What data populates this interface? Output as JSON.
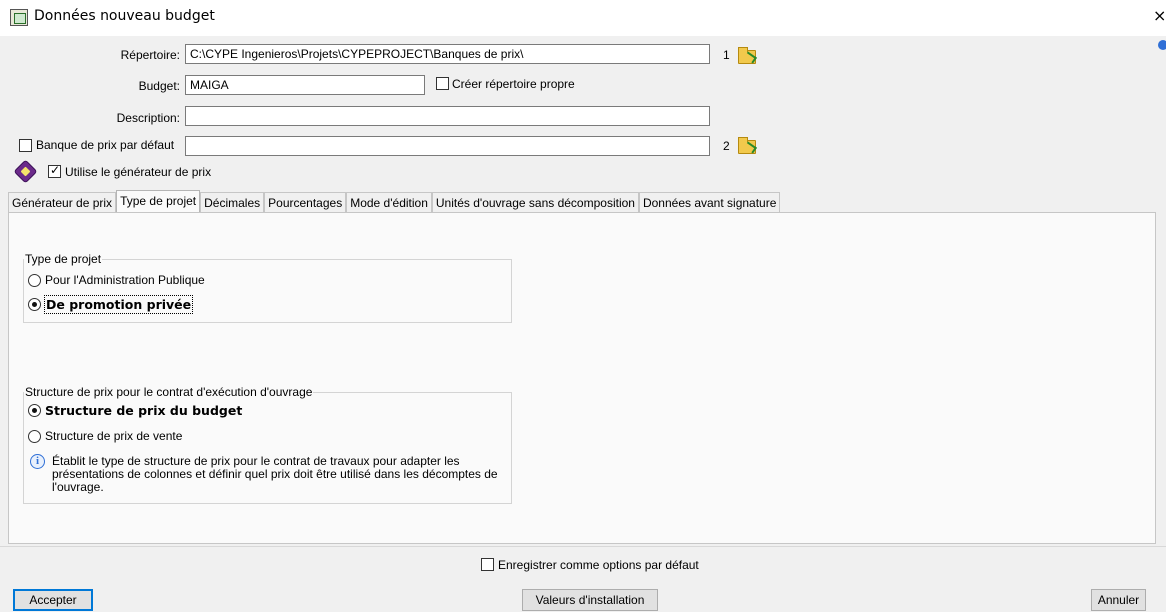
{
  "window": {
    "title": "Données nouveau budget",
    "close_glyph": "×"
  },
  "fields": {
    "repertoire": {
      "label": "Répertoire:",
      "value": "C:\\CYPE Ingenieros\\Projets\\CYPEPROJECT\\Banques de prix\\",
      "index": "1"
    },
    "budget": {
      "label": "Budget:",
      "value": "MAIGA"
    },
    "creer_repertoire": {
      "label": "Créer répertoire propre",
      "checked": false
    },
    "description": {
      "label": "Description:",
      "value": ""
    },
    "banque_defaut": {
      "label": "Banque de prix par défaut",
      "checked": false,
      "value": "",
      "index": "2"
    },
    "utilise_generateur": {
      "label": "Utilise le générateur de prix",
      "checked": true
    }
  },
  "tabs": [
    {
      "label": "Générateur de prix",
      "active": false
    },
    {
      "label": "Type de projet",
      "active": true
    },
    {
      "label": "Décimales",
      "active": false
    },
    {
      "label": "Pourcentages",
      "active": false
    },
    {
      "label": "Mode d'édition",
      "active": false
    },
    {
      "label": "Unités d'ouvrage sans décomposition",
      "active": false
    },
    {
      "label": "Données avant signature",
      "active": false
    }
  ],
  "type_projet": {
    "title": "Type de projet",
    "options": [
      {
        "label": "Pour l'Administration Publique",
        "selected": false
      },
      {
        "label": "De promotion privée",
        "selected": true
      }
    ]
  },
  "structure_prix": {
    "title": "Structure de prix pour le contrat d'exécution d'ouvrage",
    "options": [
      {
        "label": "Structure de prix du budget",
        "selected": true
      },
      {
        "label": "Structure de prix de vente",
        "selected": false
      }
    ],
    "info_lines": [
      "Établit le type de structure de prix pour le contrat de travaux pour adapter les",
      "présentations de colonnes et définir quel prix doit être utilisé dans les décomptes de",
      "l'ouvrage."
    ]
  },
  "footer": {
    "enregistrer": {
      "label": "Enregistrer comme options par défaut",
      "checked": false
    },
    "accepter": "Accepter",
    "valeurs": "Valeurs d'installation",
    "annuler": "Annuler"
  },
  "icons": {
    "app": "budget-app-icon",
    "folder": "folder-open-icon",
    "generator": "price-generator-icon",
    "info": "info-icon"
  }
}
